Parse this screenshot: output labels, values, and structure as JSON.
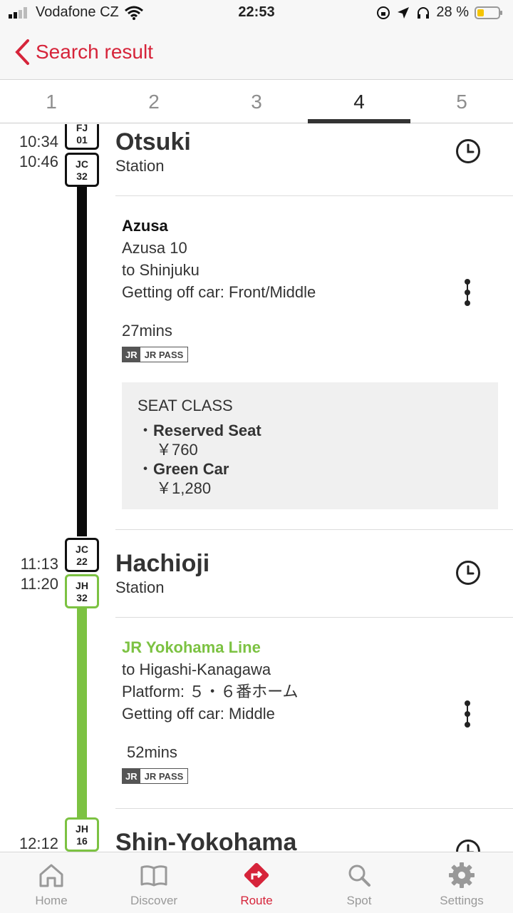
{
  "status": {
    "carrier": "Vodafone CZ",
    "time": "22:53",
    "battery": "28 %"
  },
  "nav": {
    "back_label": "Search result"
  },
  "tabs": [
    "1",
    "2",
    "3",
    "4",
    "5"
  ],
  "active_tab": "4",
  "stops": [
    {
      "times": [
        "10:34",
        "10:46"
      ],
      "badges": [
        "FJ\n01",
        "JC\n32"
      ],
      "name": "Otsuki",
      "sub": "Station"
    },
    {
      "times": [
        "11:13",
        "11:20"
      ],
      "badges": [
        "JC\n22",
        "JH\n32"
      ],
      "name": "Hachioji",
      "sub": "Station"
    },
    {
      "times": [
        "12:12"
      ],
      "badges": [
        "JH\n16"
      ],
      "name": "Shin-Yokohama",
      "sub": ""
    }
  ],
  "segments": [
    {
      "title": "Azusa",
      "train": "Azusa 10",
      "direction": "to Shinjuku",
      "car": "Getting off car: Front/Middle",
      "duration": "27mins",
      "pass_jr": "JR",
      "pass_label": "JR PASS",
      "seat": {
        "heading": "SEAT CLASS",
        "classes": [
          {
            "name": "Reserved Seat",
            "price": "￥760"
          },
          {
            "name": "Green Car",
            "price": "￥1,280"
          }
        ]
      }
    },
    {
      "title": "JR Yokohama Line",
      "direction": "to Higashi-Kanagawa",
      "platform": "Platform: ５・６番ホーム",
      "car": "Getting off car: Middle",
      "duration": "52mins",
      "pass_jr": "JR",
      "pass_label": "JR PASS",
      "line_color": "#7cc242"
    }
  ],
  "tabbar": [
    "Home",
    "Discover",
    "Route",
    "Spot",
    "Settings"
  ],
  "colors": {
    "accent": "#d6243a",
    "chuo_line": "#0a0a0a",
    "yokohama_line": "#7cc242"
  },
  "icons": [
    "wifi-icon",
    "signal-icon",
    "location-icon",
    "headphones-icon",
    "battery-icon",
    "clock-icon",
    "more-vertical-icon",
    "home-icon",
    "book-icon",
    "route-icon",
    "search-icon",
    "gear-icon"
  ]
}
